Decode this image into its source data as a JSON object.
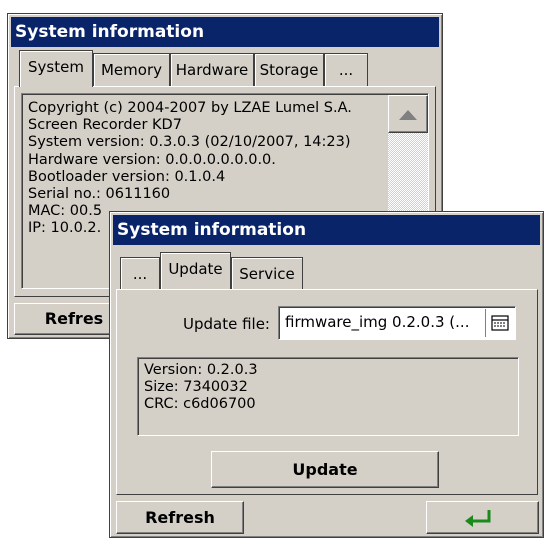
{
  "back_window": {
    "title": "System information",
    "tabs": [
      {
        "label": "System",
        "active": true
      },
      {
        "label": "Memory",
        "active": false
      },
      {
        "label": "Hardware",
        "active": false
      },
      {
        "label": "Storage",
        "active": false
      },
      {
        "label": "...",
        "active": false
      }
    ],
    "info_lines": [
      "Copyright (c) 2004-2007 by LZAE Lumel S.A.",
      "Screen Recorder KD7",
      "System version: 0.3.0.3 (02/10/2007, 14:23)",
      "Hardware version: 0.0.0.0.0.0.0.0.",
      "Bootloader version: 0.1.0.4",
      "Serial no.: 0611160",
      "MAC: 00.5",
      "IP: 10.0.2."
    ],
    "refresh_label": "Refres"
  },
  "front_window": {
    "title": "System information",
    "tabs": [
      {
        "label": "...",
        "active": false
      },
      {
        "label": "Update",
        "active": true
      },
      {
        "label": "Service",
        "active": false
      }
    ],
    "update_file_label": "Update file:",
    "update_file_value": "firmware_img 0.2.0.3 (...",
    "file_info_lines": [
      "Version: 0.2.0.3",
      "Size: 7340032",
      "CRC: c6d06700"
    ],
    "update_button_label": "Update",
    "refresh_label": "Refresh",
    "enter_icon": "enter-arrow-icon",
    "enter_icon_color": "#1a8a1a",
    "title_bar_color": "#0a246a"
  }
}
